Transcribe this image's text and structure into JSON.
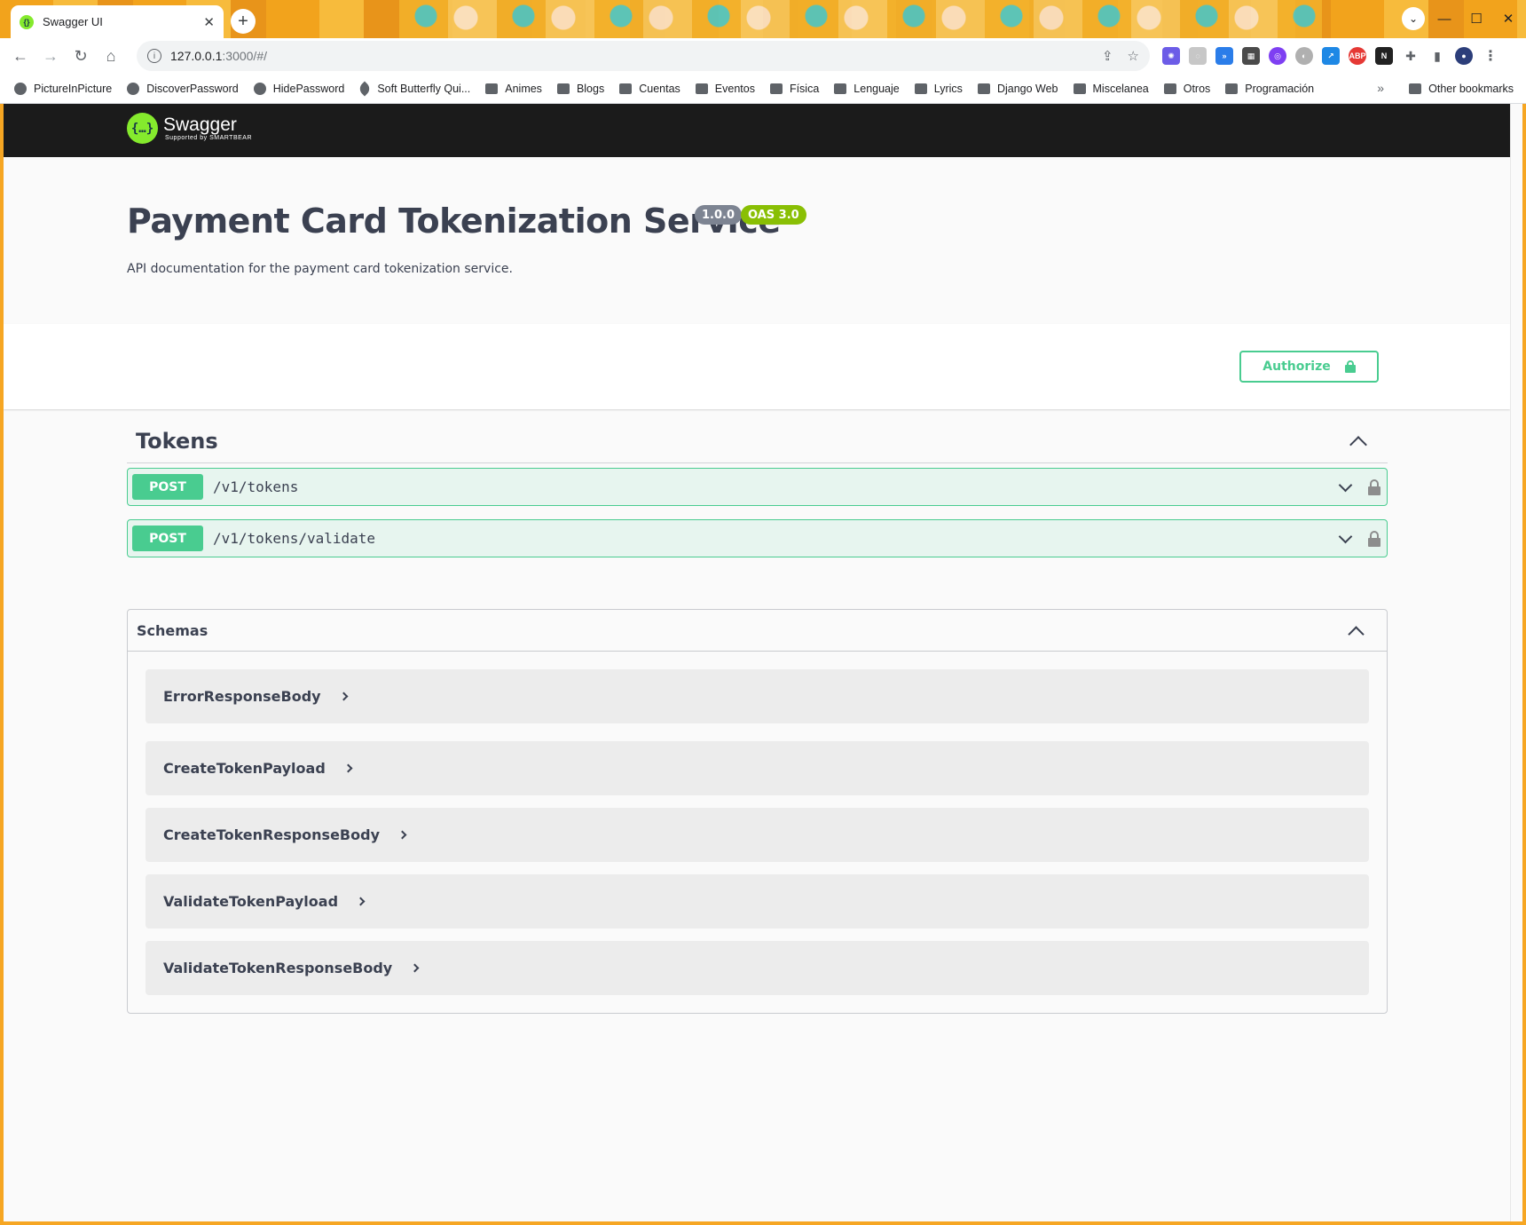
{
  "browser": {
    "tab_title": "Swagger UI",
    "url_host": "127.0.0.1",
    "url_rest": ":3000/#/",
    "bookmarks": [
      {
        "label": "PictureInPicture",
        "icon": "globe-icon"
      },
      {
        "label": "DiscoverPassword",
        "icon": "globe-icon"
      },
      {
        "label": "HidePassword",
        "icon": "globe-icon"
      },
      {
        "label": "Soft Butterfly Qui...",
        "icon": "leaf-icon"
      },
      {
        "label": "Animes",
        "icon": "folder-icon"
      },
      {
        "label": "Blogs",
        "icon": "folder-icon"
      },
      {
        "label": "Cuentas",
        "icon": "folder-icon"
      },
      {
        "label": "Eventos",
        "icon": "folder-icon"
      },
      {
        "label": "Física",
        "icon": "folder-icon"
      },
      {
        "label": "Lenguaje",
        "icon": "folder-icon"
      },
      {
        "label": "Lyrics",
        "icon": "folder-icon"
      },
      {
        "label": "Django Web",
        "icon": "folder-icon"
      },
      {
        "label": "Miscelanea",
        "icon": "folder-icon"
      },
      {
        "label": "Otros",
        "icon": "folder-icon"
      },
      {
        "label": "Programación",
        "icon": "folder-icon"
      }
    ],
    "more_bookmarks": "»",
    "other_bookmarks": "Other bookmarks"
  },
  "swagger": {
    "brand": "Swagger",
    "brand_sub": "Supported by SMARTBEAR",
    "logo_glyph": "{…}"
  },
  "info": {
    "title": "Payment Card Tokenization Service",
    "version": "1.0.0",
    "oas": "OAS 3.0",
    "description": "API documentation for the payment card tokenization service."
  },
  "authorize_label": "Authorize",
  "tags": [
    {
      "name": "Tokens",
      "operations": [
        {
          "method": "POST",
          "path": "/v1/tokens"
        },
        {
          "method": "POST",
          "path": "/v1/tokens/validate"
        }
      ]
    }
  ],
  "schemas": {
    "title": "Schemas",
    "models": [
      "ErrorResponseBody",
      "CreateTokenPayload",
      "CreateTokenResponseBody",
      "ValidateTokenPayload",
      "ValidateTokenResponseBody"
    ]
  },
  "colors": {
    "post": "#49cc90",
    "swagger_green": "#85ea2d",
    "topbar": "#1b1b1b",
    "text": "#3b4151"
  }
}
